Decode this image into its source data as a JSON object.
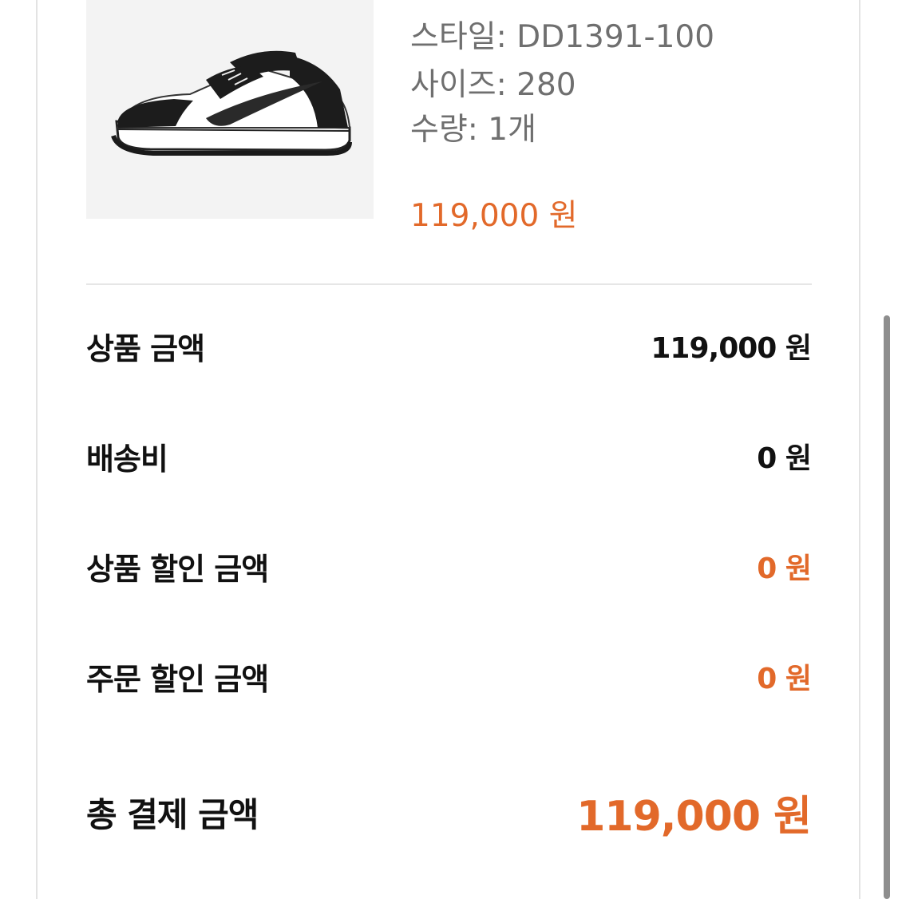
{
  "product": {
    "image_alt": "Nike Dunk Low black and white sneaker",
    "style": "스타일: DD1391-100",
    "size": "사이즈: 280",
    "quantity": "수량: 1개",
    "price": "119,000 원"
  },
  "summary": {
    "subtotal": {
      "label": "상품 금액",
      "value": "119,000 원"
    },
    "shipping": {
      "label": "배송비",
      "value": "0 원"
    },
    "product_discount": {
      "label": "상품 할인 금액",
      "value": "0 원"
    },
    "order_discount": {
      "label": "주문 할인 금액",
      "value": "0 원"
    },
    "total": {
      "label": "총 결제 금액",
      "value": "119,000 원"
    }
  },
  "colors": {
    "accent": "#e2692a",
    "text_primary": "#111111",
    "text_secondary": "#6f6f6f",
    "divider": "#e6e6e6"
  }
}
